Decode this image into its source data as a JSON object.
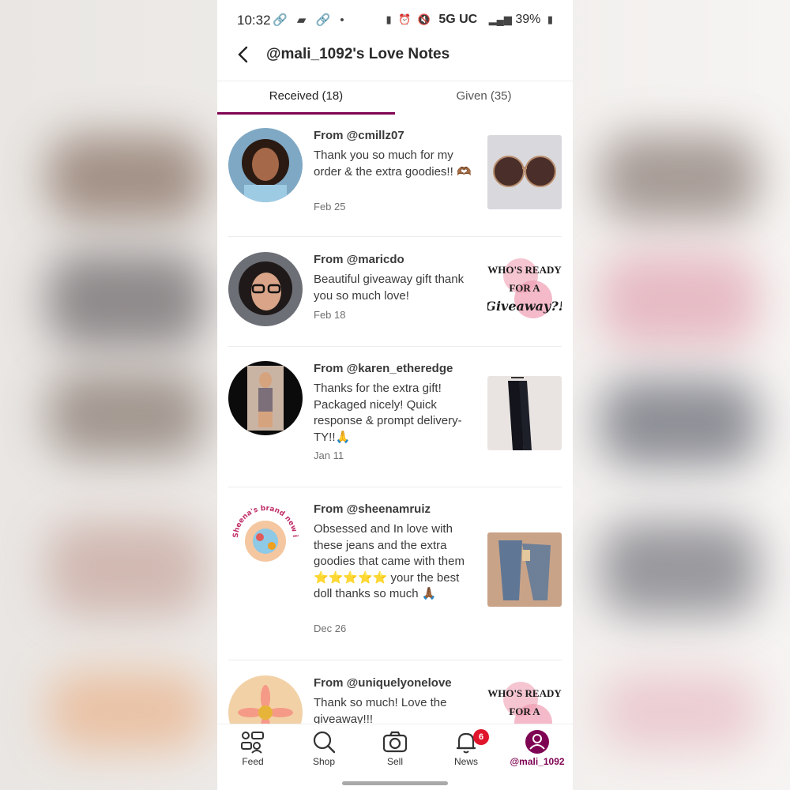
{
  "status_bar": {
    "time": "10:32",
    "left_icons": "🔗 ▰ 🔗 •",
    "network": "5G UC",
    "battery": "39%"
  },
  "header": {
    "title": "@mali_1092's Love Notes"
  },
  "tabs": [
    {
      "label": "Received (18)",
      "active": true
    },
    {
      "label": "Given (35)",
      "active": false
    }
  ],
  "notes": [
    {
      "from": "From @cmillz07",
      "message": "Thank you so much for my order & the extra goodies!! 🫶🏾",
      "date": "Feb 25",
      "thumb": "sunglasses-photo"
    },
    {
      "from": "From @maricdo",
      "message": "Beautiful giveaway gift thank you so much love!",
      "date": "Feb 18",
      "thumb": "giveaway-graphic"
    },
    {
      "from": "From @karen_etheredge",
      "message": "Thanks for the extra gift! Packaged nicely! Quick response & prompt delivery- TY!!🙏",
      "date": "Jan 11",
      "thumb": "black-pants-photo"
    },
    {
      "from": "From @sheenamruiz",
      "message": "Obsessed and In love with these jeans and the extra goodies that came with them ⭐⭐⭐⭐⭐ your the best doll thanks so much 🙏🏾",
      "date": "Dec 26",
      "thumb": "jeans-photo"
    },
    {
      "from": "From @uniquelyonelove",
      "message": "Thank so much! Love the giveaway!!!",
      "date": "",
      "thumb": "giveaway-graphic"
    }
  ],
  "graphics": {
    "giveaway_line1": "WHO'S READY",
    "giveaway_line2": "FOR A",
    "giveaway_line3": "Giveaway?!",
    "sheena_avatar_text": "Sheena's brand new items"
  },
  "bottom_nav": [
    {
      "label": "Feed",
      "icon": "feed-icon"
    },
    {
      "label": "Shop",
      "icon": "search-icon"
    },
    {
      "label": "Sell",
      "icon": "camera-icon"
    },
    {
      "label": "News",
      "icon": "bell-icon",
      "badge": "6"
    },
    {
      "label": "@mali_1092",
      "icon": "profile-icon",
      "active": true
    }
  ],
  "colors": {
    "accent": "#7f0353",
    "badge": "#e0142a"
  }
}
